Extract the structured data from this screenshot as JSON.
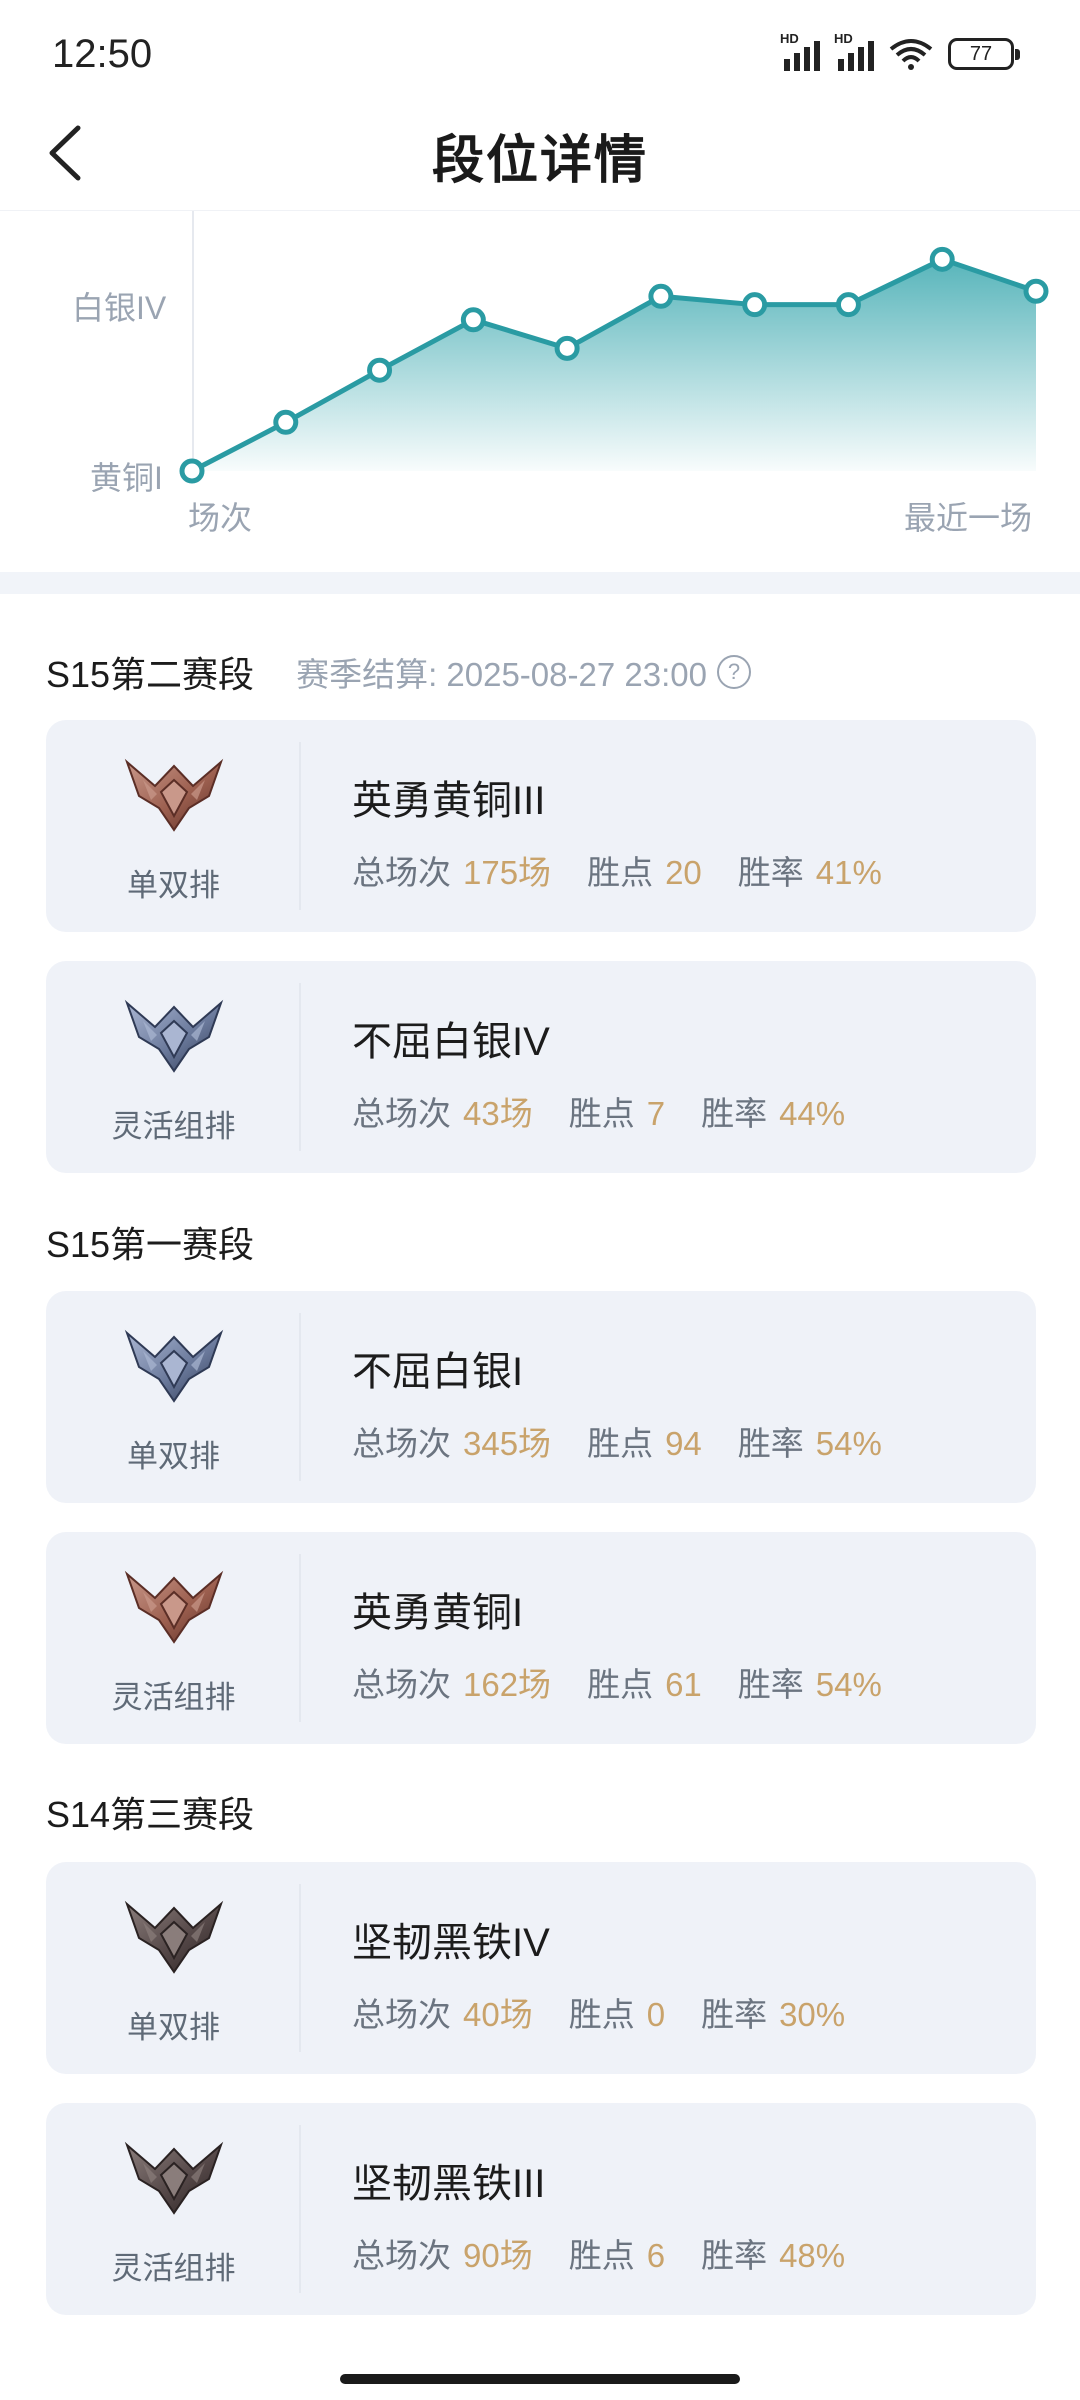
{
  "status_bar": {
    "time": "12:50",
    "battery": "77",
    "signal_label": "HD"
  },
  "header": {
    "title": "段位详情"
  },
  "chart_data": {
    "type": "area",
    "x": [
      1,
      2,
      3,
      4,
      5,
      6,
      7,
      8,
      9,
      10
    ],
    "values": [
      0,
      0.29,
      0.6,
      0.9,
      0.73,
      1.04,
      0.99,
      0.99,
      1.26,
      1.07
    ],
    "y_ticks": [
      "黄铜I",
      "白银IV"
    ],
    "x_labels": [
      "场次",
      "最近一场"
    ],
    "colors": {
      "line": "#2a9ba3",
      "fill": "#4fb1b7"
    }
  },
  "seasons": [
    {
      "title": "S15第二赛段",
      "settlement": "赛季结算: 2025-08-27 23:00",
      "cards": [
        {
          "queue": "单双排",
          "rank": "英勇黄铜III",
          "tier": "bronze",
          "games_label": "总场次",
          "games": "175场",
          "lp_label": "胜点",
          "lp": "20",
          "wr_label": "胜率",
          "wr": "41%"
        },
        {
          "queue": "灵活组排",
          "rank": "不屈白银IV",
          "tier": "silver",
          "games_label": "总场次",
          "games": "43场",
          "lp_label": "胜点",
          "lp": "7",
          "wr_label": "胜率",
          "wr": "44%"
        }
      ]
    },
    {
      "title": "S15第一赛段",
      "cards": [
        {
          "queue": "单双排",
          "rank": "不屈白银I",
          "tier": "silver",
          "games_label": "总场次",
          "games": "345场",
          "lp_label": "胜点",
          "lp": "94",
          "wr_label": "胜率",
          "wr": "54%"
        },
        {
          "queue": "灵活组排",
          "rank": "英勇黄铜I",
          "tier": "bronze",
          "games_label": "总场次",
          "games": "162场",
          "lp_label": "胜点",
          "lp": "61",
          "wr_label": "胜率",
          "wr": "54%"
        }
      ]
    },
    {
      "title": "S14第三赛段",
      "cards": [
        {
          "queue": "单双排",
          "rank": "坚韧黑铁IV",
          "tier": "iron",
          "games_label": "总场次",
          "games": "40场",
          "lp_label": "胜点",
          "lp": "0",
          "wr_label": "胜率",
          "wr": "30%"
        },
        {
          "queue": "灵活组排",
          "rank": "坚韧黑铁III",
          "tier": "iron",
          "games_label": "总场次",
          "games": "90场",
          "lp_label": "胜点",
          "lp": "6",
          "wr_label": "胜率",
          "wr": "48%"
        }
      ]
    }
  ],
  "tier_colors": {
    "bronze": {
      "light": "#c9988a",
      "dark": "#5b2e26",
      "mid": "#9c5f4f"
    },
    "silver": {
      "light": "#aab6d2",
      "dark": "#2f3a55",
      "mid": "#6b7a9c"
    },
    "iron": {
      "light": "#8a7d7b",
      "dark": "#2a2222",
      "mid": "#554848"
    }
  },
  "icons": {
    "back": "chevron-left-icon",
    "help": "question-circle-icon"
  }
}
